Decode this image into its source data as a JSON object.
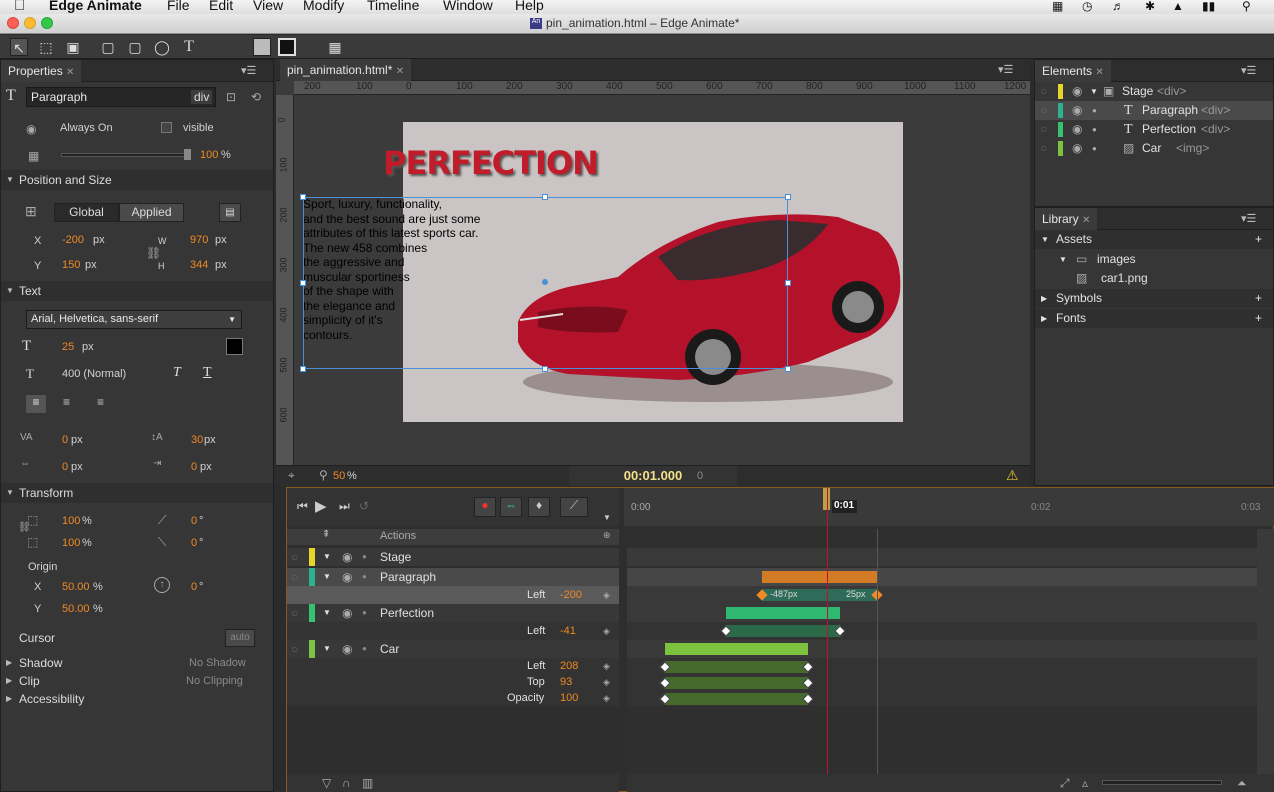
{
  "menubar": {
    "app": "Edge Animate",
    "items": [
      "File",
      "Edit",
      "View",
      "Modify",
      "Timeline",
      "Window",
      "Help"
    ]
  },
  "window": {
    "title": "pin_animation.html – Edge Animate*"
  },
  "properties": {
    "tab": "Properties",
    "element_name": "Paragraph",
    "element_tag": "div",
    "always_on": "Always On",
    "overflow": "visible",
    "opacity": "100",
    "opacity_unit": "%",
    "pos_section": "Position and Size",
    "global_btn": "Global",
    "applied_btn": "Applied",
    "x_label": "X",
    "x_value": "-200",
    "x_unit": "px",
    "w_label": "W",
    "w_value": "970",
    "w_unit": "px",
    "y_label": "Y",
    "y_value": "150",
    "y_unit": "px",
    "h_label": "H",
    "h_value": "344",
    "h_unit": "px",
    "text_section": "Text",
    "font": "Arial, Helvetica, sans-serif",
    "font_size": "25",
    "font_size_unit": "px",
    "font_weight": "400 (Normal)",
    "letter_spacing": "0",
    "ls_unit": "px",
    "line_height": "30",
    "lh_unit": "px",
    "word_spacing": "0",
    "ws_unit": "px",
    "indent": "0",
    "ind_unit": "px",
    "transform_section": "Transform",
    "scale_x": "100",
    "scale_y": "100",
    "pct": "%",
    "skew_x": "0",
    "skew_y": "0",
    "deg": "°",
    "origin_label": "Origin",
    "origin_x": "50.00",
    "origin_y": "50.00",
    "rotate": "0",
    "cursor_section": "Cursor",
    "cursor_value": "auto",
    "shadow_section": "Shadow",
    "shadow_value": "No Shadow",
    "clip_section": "Clip",
    "clip_value": "No Clipping",
    "accessibility_section": "Accessibility"
  },
  "stage": {
    "tab": "pin_animation.html*",
    "ruler_top": [
      "200",
      "100",
      "0",
      "100",
      "200",
      "300",
      "400",
      "500",
      "600",
      "700",
      "800",
      "900",
      "1000",
      "1100",
      "1200"
    ],
    "ruler_left": [
      "0",
      "100",
      "200",
      "300",
      "400",
      "500",
      "600"
    ],
    "headline": "PERFECTION",
    "paragraph": [
      "Sport, luxury, functionality,",
      "and the best sound are just some",
      "attributes of this latest sports car.",
      "The new 458 combines",
      "the aggressive and",
      "muscular sportiness",
      "of the shape with",
      "the elegance and",
      "simplicity of it's",
      "contours."
    ],
    "zoom": "50",
    "zoom_unit": "%",
    "time": "00:01.000",
    "frame": "0"
  },
  "elements_panel": {
    "tab": "Elements",
    "items": [
      {
        "name": "Stage",
        "tag": "<div>",
        "color": "#e8d52a"
      },
      {
        "name": "Paragraph",
        "tag": "<div>",
        "color": "#2bb38d"
      },
      {
        "name": "Perfection",
        "tag": "<div>",
        "color": "#36c26e"
      },
      {
        "name": "Car",
        "tag": "<img>",
        "color": "#7cc23f"
      }
    ]
  },
  "library": {
    "tab": "Library",
    "assets": "Assets",
    "images": "images",
    "file": "car1.png",
    "symbols": "Symbols",
    "fonts": "Fonts"
  },
  "timeline": {
    "actions": "Actions",
    "time_labels": [
      "0:00",
      "0:01",
      "0:02",
      "0:03"
    ],
    "rows": [
      {
        "name": "Stage"
      },
      {
        "name": "Paragraph",
        "prop": "Left",
        "value": "-200",
        "kf_start": "-487px",
        "kf_end": "25px"
      },
      {
        "name": "Perfection",
        "prop": "Left",
        "value": "-41"
      },
      {
        "name": "Car",
        "props": [
          {
            "prop": "Left",
            "value": "208"
          },
          {
            "prop": "Top",
            "value": "93"
          },
          {
            "prop": "Opacity",
            "value": "100"
          }
        ]
      }
    ]
  },
  "colors": {
    "accent": "#f08a24",
    "playhead": "#c0102a",
    "selection": "#4a90d9"
  }
}
